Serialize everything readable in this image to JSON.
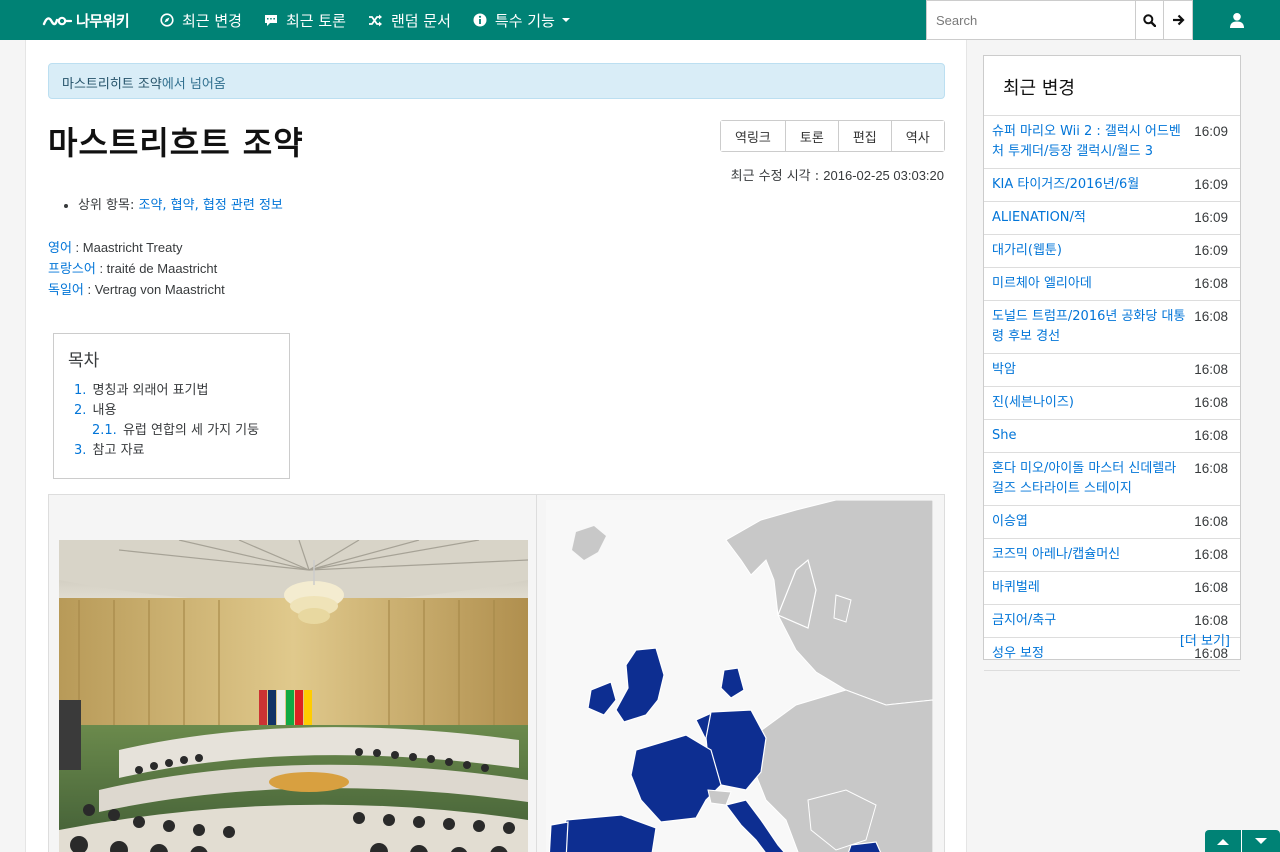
{
  "nav": {
    "logo_text": "나무위키",
    "items": [
      {
        "label": "최근 변경",
        "icon": "compass-icon"
      },
      {
        "label": "최근 토론",
        "icon": "comment-icon"
      },
      {
        "label": "랜덤 문서",
        "icon": "shuffle-icon"
      },
      {
        "label": "특수 기능",
        "icon": "info-icon",
        "dropdown": true
      }
    ],
    "search_placeholder": "Search",
    "search_icon": "search-icon",
    "go_icon": "arrow-right-icon",
    "user_icon": "user-icon"
  },
  "colors": {
    "brand": "#008275",
    "link": "#0275d8",
    "alert_bg": "#d9edf7",
    "map_eu": "#0d2e91",
    "map_other": "#c8c8c8"
  },
  "article": {
    "redirect_link": "마스트리히트 조약",
    "redirect_suffix": "에서 넘어옴",
    "title": "마스트리흐트 조약",
    "tabs": [
      "역링크",
      "토론",
      "편집",
      "역사"
    ],
    "modified_label": "최근 수정 시각 : ",
    "modified_time": "2016-02-25 03:03:20",
    "parent_label": "상위 항목: ",
    "parent_link": "조약, 협약, 협정 관련 정보",
    "languages": [
      {
        "name": "영어",
        "value": " : Maastricht Treaty"
      },
      {
        "name": "프랑스어",
        "value": " : traité de Maastricht"
      },
      {
        "name": "독일어",
        "value": " : Vertrag von Maastricht"
      }
    ],
    "toc": {
      "title": "목차",
      "items": [
        {
          "num": "1.",
          "text": "명칭과 외래어 표기법"
        },
        {
          "num": "2.",
          "text": "내용"
        },
        {
          "num": "2.1.",
          "text": "유럽 연합의 세 가지 기둥"
        },
        {
          "num": "3.",
          "text": "참고 자료"
        }
      ]
    }
  },
  "sidebar": {
    "title": "최근 변경",
    "rows": [
      {
        "name": "슈퍼 마리오 Wii 2 : 갤럭시 어드벤처 투게더/등장 갤럭시/월드 3",
        "time": "16:09"
      },
      {
        "name": "KIA 타이거즈/2016년/6월",
        "time": "16:09"
      },
      {
        "name": "ALIENATION/적",
        "time": "16:09"
      },
      {
        "name": "대가리(웹툰)",
        "time": "16:09"
      },
      {
        "name": "미르체아 엘리아데",
        "time": "16:08"
      },
      {
        "name": "도널드 트럼프/2016년 공화당 대통령 후보 경선",
        "time": "16:08"
      },
      {
        "name": "박암",
        "time": "16:08"
      },
      {
        "name": "진(세븐나이즈)",
        "time": "16:08"
      },
      {
        "name": "She",
        "time": "16:08"
      },
      {
        "name": "혼다 미오/아이돌 마스터 신데렐라 걸즈 스타라이트 스테이지",
        "time": "16:08"
      },
      {
        "name": "이승엽",
        "time": "16:08"
      },
      {
        "name": "코즈믹 아레나/캡슐머신",
        "time": "16:08"
      },
      {
        "name": "바퀴벌레",
        "time": "16:08"
      },
      {
        "name": "금지어/축구",
        "time": "16:08"
      },
      {
        "name": "성우 보정",
        "time": "16:08"
      }
    ],
    "more": "[더 보기]"
  }
}
